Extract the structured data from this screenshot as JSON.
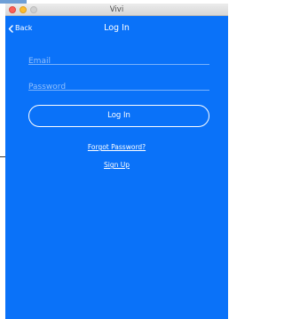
{
  "window": {
    "title": "Vivi"
  },
  "navbar": {
    "back_label": "Back",
    "title": "Log In"
  },
  "form": {
    "email_placeholder": "Email",
    "password_placeholder": "Password",
    "login_label": "Log In"
  },
  "links": {
    "forgot_password": "Forgot Password?",
    "sign_up": "Sign Up"
  },
  "colors": {
    "background": "#0a72f9",
    "text": "#ffffff"
  }
}
